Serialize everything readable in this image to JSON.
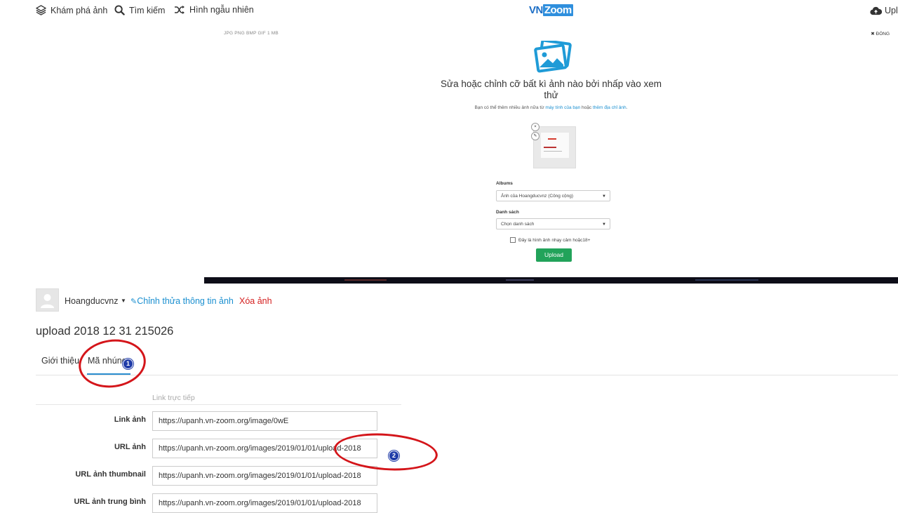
{
  "topnav": {
    "explore_label": "Khám phá ảnh",
    "search_label": "Tìm kiếm",
    "random_label": "Hình ngẫu nhiên",
    "logo_vn": "VN",
    "logo_zoom": "Zoom",
    "upload_label": "Upl"
  },
  "modal": {
    "formats": "JPG PNG BMP GIF  1 MB",
    "close_label": "ĐÓNG",
    "title_line1": "Sửa hoặc chỉnh cỡ bất kì ảnh nào bởi nhấp vào xem",
    "title_line2": "thử",
    "sub_prefix": "Bạn có thể thêm nhiều ảnh nữa từ ",
    "sub_link1": "máy tính của bạn",
    "sub_mid": " hoặc ",
    "sub_link2": "thêm địa chỉ ảnh",
    "sub_suffix": ".",
    "thumb_remove": "×",
    "thumb_edit": "✎",
    "albums_label": "Albums",
    "albums_value": "Ảnh của Hoangducvnz (Công cộng)",
    "list_label": "Danh sách",
    "list_value": "Chọn danh sách",
    "nsfw_label": "Đây là hình ảnh nhạy cảm hoặc18+",
    "upload_button": "Upload"
  },
  "image_page": {
    "username": "Hoangducvnz",
    "edit_label": "Chỉnh thửa thông tin ảnh",
    "delete_label": "Xóa ảnh",
    "title": "upload 2018 12 31 215026",
    "tabs": [
      {
        "label": "Giới thiệu"
      },
      {
        "label": "Mã nhúng"
      }
    ],
    "section_header": "Link trực tiếp",
    "rows": [
      {
        "label": "Link ảnh",
        "value": "https://upanh.vn-zoom.org/image/0wE"
      },
      {
        "label": "URL ảnh",
        "value": "https://upanh.vn-zoom.org/images/2019/01/01/upload-2018"
      },
      {
        "label": "URL ảnh thumbnail",
        "value": "https://upanh.vn-zoom.org/images/2019/01/01/upload-2018"
      },
      {
        "label": "URL ảnh trung bình",
        "value": "https://upanh.vn-zoom.org/images/2019/01/01/upload-2018"
      }
    ]
  },
  "annotations": {
    "marker1": "1",
    "marker2": "2",
    "ring_color": "#d4151a",
    "marker_color": "#1f3ba8"
  },
  "colors": {
    "link_blue": "#1a8fd0",
    "danger_red": "#d41f1f",
    "upload_green": "#22a35a",
    "tab_active": "#2b8ed0"
  }
}
